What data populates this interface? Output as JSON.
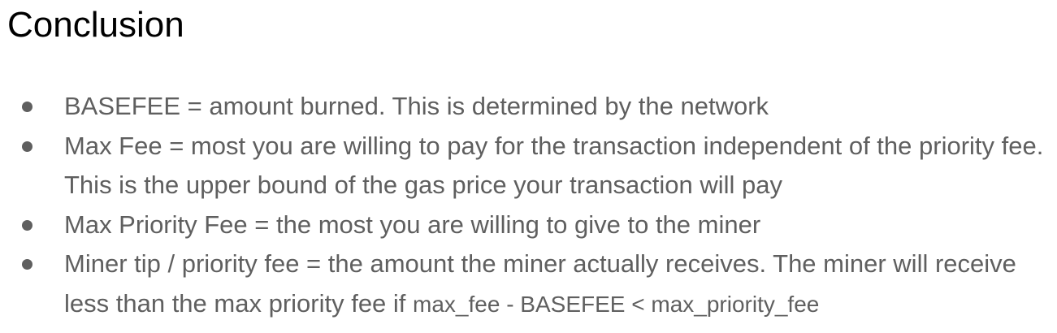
{
  "slide": {
    "title": "Conclusion",
    "bullets": [
      {
        "text": "BASEFEE = amount burned. This is determined by the network"
      },
      {
        "text": "Max Fee = most you are willing to pay for the transaction independent of the priority fee. This is the upper bound of the gas price your transaction will pay"
      },
      {
        "text": "Max Priority Fee = the most you are willing to give to the miner"
      },
      {
        "text": "Miner tip / priority fee = the amount the miner actually receives. The miner will receive less than the max priority fee if ",
        "code": "max_fee - BASEFEE < max_priority_fee"
      }
    ]
  }
}
